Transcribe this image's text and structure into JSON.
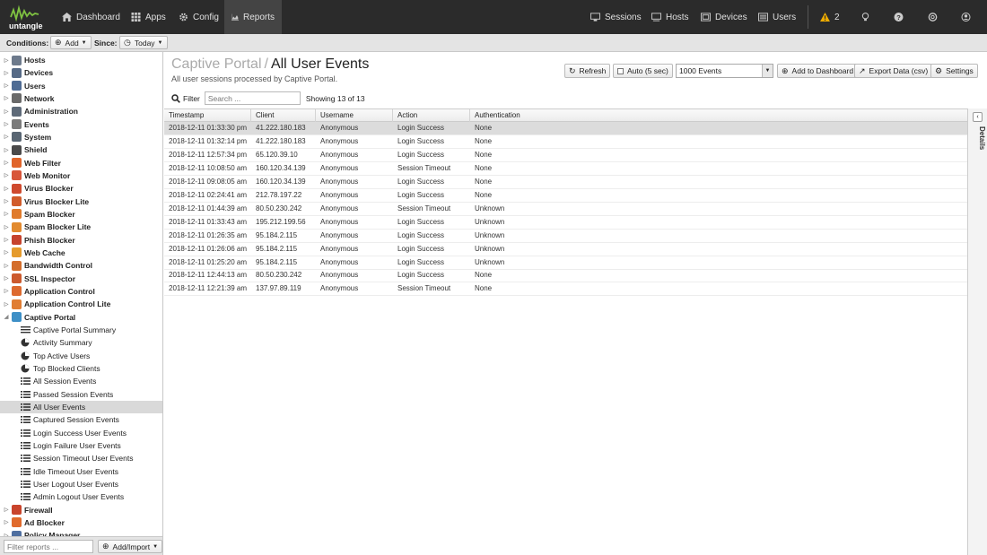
{
  "topbar": {
    "logo_text": "untangle",
    "nav_left": [
      {
        "label": "Dashboard",
        "icon": "home-icon"
      },
      {
        "label": "Apps",
        "icon": "apps-grid-icon"
      },
      {
        "label": "Config",
        "icon": "gear-icon"
      },
      {
        "label": "Reports",
        "icon": "area-chart-icon",
        "active": true
      }
    ],
    "nav_right": [
      {
        "label": "Sessions",
        "icon": "sessions-icon"
      },
      {
        "label": "Hosts",
        "icon": "hosts-icon"
      },
      {
        "label": "Devices",
        "icon": "devices-icon"
      },
      {
        "label": "Users",
        "icon": "users-icon"
      }
    ],
    "alert_count": "2",
    "accent": "#f0ad00"
  },
  "conditions": {
    "label": "Conditions:",
    "add_label": "Add",
    "since_label": "Since:",
    "since_value": "Today"
  },
  "tree": {
    "top": [
      {
        "label": "Hosts",
        "color": "#6d7a8c"
      },
      {
        "label": "Devices",
        "color": "#566a86"
      },
      {
        "label": "Users",
        "color": "#4f6c94"
      },
      {
        "label": "Network",
        "color": "#6a6a6a"
      },
      {
        "label": "Administration",
        "color": "#5e6a78"
      },
      {
        "label": "Events",
        "color": "#7b7b7b"
      },
      {
        "label": "System",
        "color": "#596673"
      },
      {
        "label": "Shield",
        "color": "#4a4a4a"
      },
      {
        "label": "Web Filter",
        "color": "#e0642a"
      },
      {
        "label": "Web Monitor",
        "color": "#d8563a"
      },
      {
        "label": "Virus Blocker",
        "color": "#cf4a2e"
      },
      {
        "label": "Virus Blocker Lite",
        "color": "#d15c2b"
      },
      {
        "label": "Spam Blocker",
        "color": "#e07b2c"
      },
      {
        "label": "Spam Blocker Lite",
        "color": "#e28a2f"
      },
      {
        "label": "Phish Blocker",
        "color": "#c6432e"
      },
      {
        "label": "Web Cache",
        "color": "#e59b2d"
      },
      {
        "label": "Bandwidth Control",
        "color": "#d46e2c"
      },
      {
        "label": "SSL Inspector",
        "color": "#cc5a2e"
      },
      {
        "label": "Application Control",
        "color": "#dd6a2f"
      },
      {
        "label": "Application Control Lite",
        "color": "#e07d33"
      },
      {
        "label": "Captive Portal",
        "color": "#3d8fc6",
        "expanded": true
      }
    ],
    "captive_children": [
      {
        "label": "Captive Portal Summary",
        "icon": "text-lines-icon"
      },
      {
        "label": "Activity Summary",
        "icon": "pie-chart-icon"
      },
      {
        "label": "Top Active Users",
        "icon": "pie-chart-icon"
      },
      {
        "label": "Top Blocked Clients",
        "icon": "pie-chart-icon"
      },
      {
        "label": "All Session Events",
        "icon": "list-icon"
      },
      {
        "label": "Passed Session Events",
        "icon": "list-icon"
      },
      {
        "label": "All User Events",
        "icon": "list-icon",
        "selected": true
      },
      {
        "label": "Captured Session Events",
        "icon": "list-icon"
      },
      {
        "label": "Login Success User Events",
        "icon": "list-icon"
      },
      {
        "label": "Login Failure User Events",
        "icon": "list-icon"
      },
      {
        "label": "Session Timeout User Events",
        "icon": "list-icon"
      },
      {
        "label": "Idle Timeout User Events",
        "icon": "list-icon"
      },
      {
        "label": "User Logout User Events",
        "icon": "list-icon"
      },
      {
        "label": "Admin Logout User Events",
        "icon": "list-icon"
      }
    ],
    "bottom": [
      {
        "label": "Firewall",
        "color": "#c9442c"
      },
      {
        "label": "Ad Blocker",
        "color": "#e06a2c"
      },
      {
        "label": "Policy Manager",
        "color": "#4f6fa0"
      }
    ],
    "filter_placeholder": "Filter reports ...",
    "add_import_label": "Add/Import"
  },
  "main": {
    "title_prefix": "Captive Portal",
    "title_sep": "/",
    "title": "All User Events",
    "subtitle": "All user sessions processed by Captive Portal.",
    "toolbar": {
      "refresh": "Refresh",
      "auto": "Auto (5 sec)",
      "events_select": "1000 Events",
      "add_dashboard": "Add to Dashboard",
      "export": "Export Data (csv)",
      "settings": "Settings"
    },
    "filter_label": "Filter",
    "search_placeholder": "Search ...",
    "showing": "Showing 13 of 13",
    "details_label": "Details"
  },
  "table": {
    "columns": [
      "Timestamp",
      "Client",
      "Username",
      "Action",
      "Authentication"
    ],
    "rows": [
      [
        "2018-12-11 01:33:30 pm",
        "41.222.180.183",
        "Anonymous",
        "Login Success",
        "None"
      ],
      [
        "2018-12-11 01:32:14 pm",
        "41.222.180.183",
        "Anonymous",
        "Login Success",
        "None"
      ],
      [
        "2018-12-11 12:57:34 pm",
        "65.120.39.10",
        "Anonymous",
        "Login Success",
        "None"
      ],
      [
        "2018-12-11 10:08:50 am",
        "160.120.34.139",
        "Anonymous",
        "Session Timeout",
        "None"
      ],
      [
        "2018-12-11 09:08:05 am",
        "160.120.34.139",
        "Anonymous",
        "Login Success",
        "None"
      ],
      [
        "2018-12-11 02:24:41 am",
        "212.78.197.22",
        "Anonymous",
        "Login Success",
        "None"
      ],
      [
        "2018-12-11 01:44:39 am",
        "80.50.230.242",
        "Anonymous",
        "Session Timeout",
        "Unknown"
      ],
      [
        "2018-12-11 01:33:43 am",
        "195.212.199.56",
        "Anonymous",
        "Login Success",
        "Unknown"
      ],
      [
        "2018-12-11 01:26:35 am",
        "95.184.2.115",
        "Anonymous",
        "Login Success",
        "Unknown"
      ],
      [
        "2018-12-11 01:26:06 am",
        "95.184.2.115",
        "Anonymous",
        "Login Success",
        "Unknown"
      ],
      [
        "2018-12-11 01:25:20 am",
        "95.184.2.115",
        "Anonymous",
        "Login Success",
        "Unknown"
      ],
      [
        "2018-12-11 12:44:13 am",
        "80.50.230.242",
        "Anonymous",
        "Login Success",
        "None"
      ],
      [
        "2018-12-11 12:21:39 am",
        "137.97.89.119",
        "Anonymous",
        "Session Timeout",
        "None"
      ]
    ]
  }
}
